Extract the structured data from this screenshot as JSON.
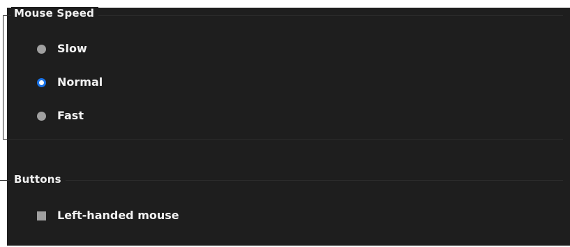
{
  "mouse_speed": {
    "title": "Mouse Speed",
    "options": [
      {
        "label": "Slow",
        "checked": false
      },
      {
        "label": "Normal",
        "checked": true
      },
      {
        "label": "Fast",
        "checked": false
      }
    ]
  },
  "buttons": {
    "title": "Buttons",
    "left_handed_label": "Left-handed mouse",
    "left_handed_checked": false
  },
  "colors": {
    "background": "#1e1e1e",
    "text": "#f2f2f2",
    "radio_unchecked": "#a0a0a0",
    "radio_checked_accent": "#1a73e8"
  }
}
